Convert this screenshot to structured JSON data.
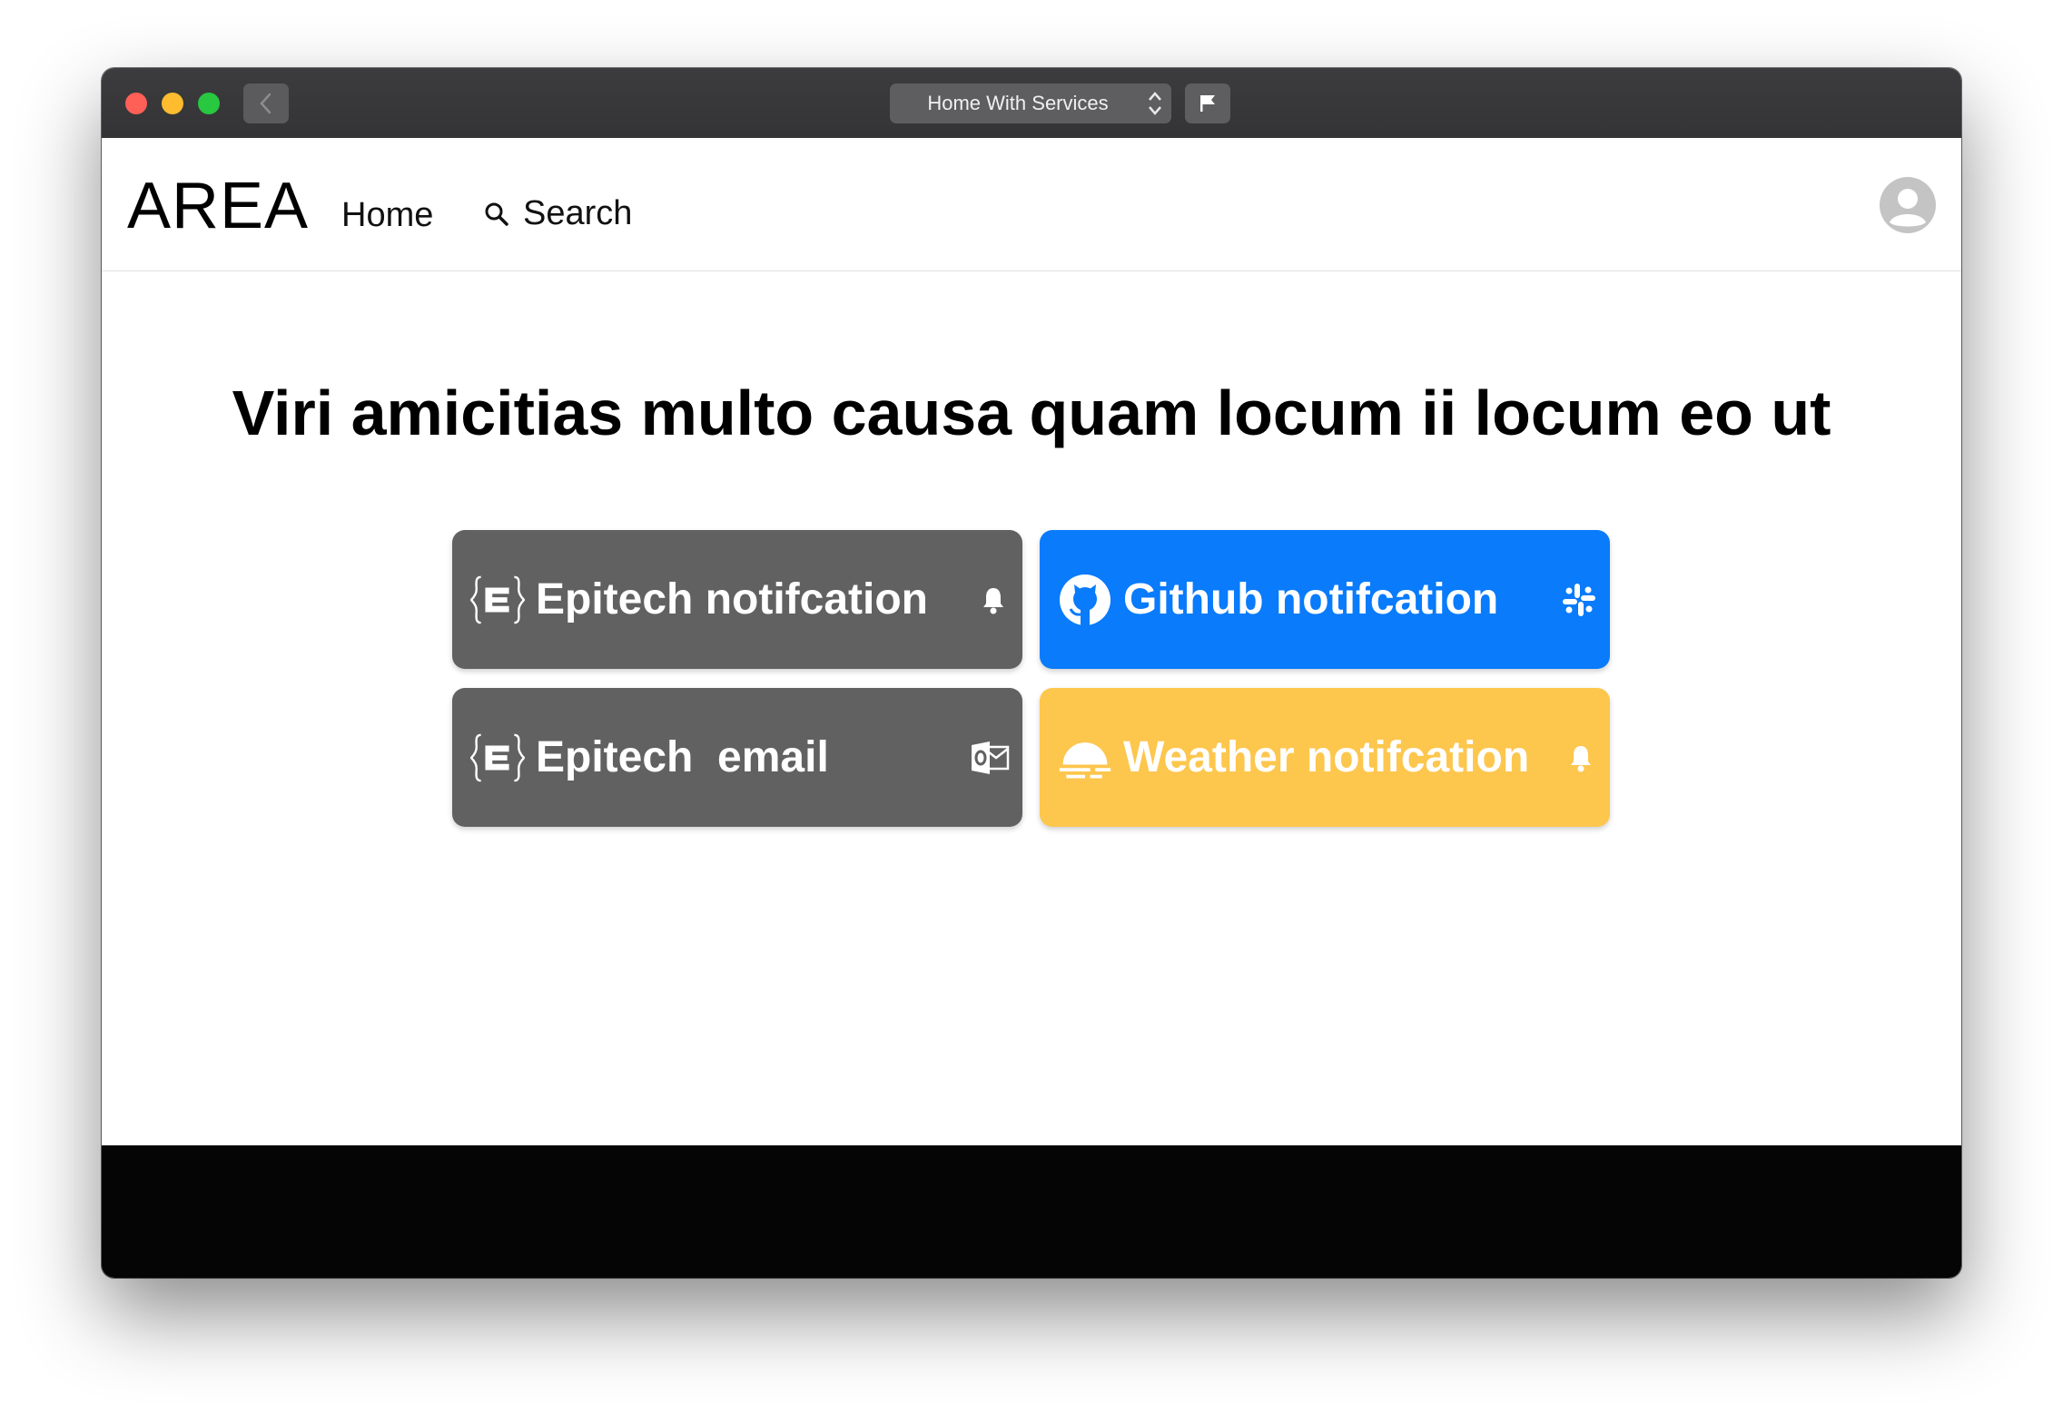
{
  "window": {
    "scheme_label": "Home With Services"
  },
  "appbar": {
    "logo": "AREA",
    "nav_home": "Home",
    "nav_search": "Search"
  },
  "main": {
    "headline": "Viri amicitias multo causa quam locum ii locum eo ut",
    "cards": [
      {
        "title": "Epitech notifcation",
        "lead_icon": "epitech-logo-icon",
        "trail_icon": "bell-icon",
        "color": "#616161"
      },
      {
        "title": "Github notifcation",
        "lead_icon": "github-icon",
        "trail_icon": "slack-icon",
        "color": "#097bfb"
      },
      {
        "title": "Epitech  email",
        "lead_icon": "epitech-logo-icon",
        "trail_icon": "outlook-icon",
        "color": "#616161"
      },
      {
        "title": "Weather notifcation",
        "lead_icon": "weather-sunset-icon",
        "trail_icon": "bell-icon",
        "color": "#fdc64d"
      }
    ]
  },
  "colors": {
    "footer": "#050505",
    "titlebar": "#3a3a3c"
  }
}
